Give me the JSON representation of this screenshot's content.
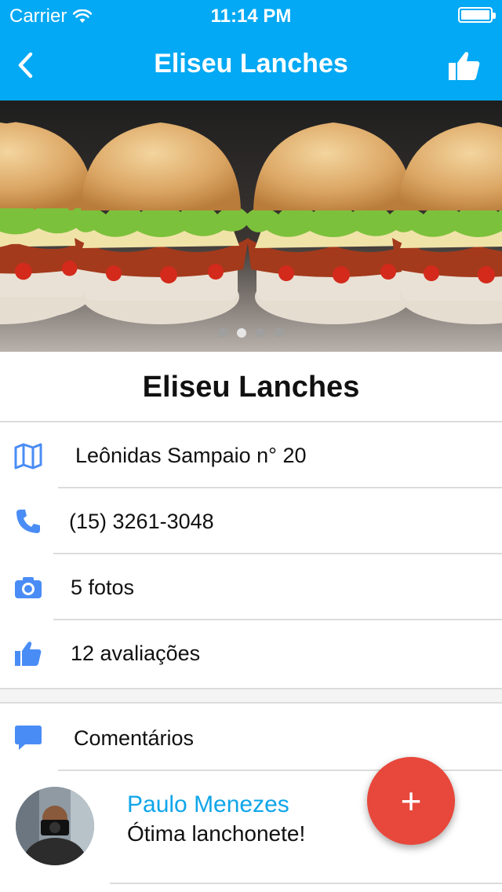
{
  "status_bar": {
    "carrier": "Carrier",
    "time": "11:14 PM"
  },
  "nav": {
    "title": "Eliseu Lanches",
    "back_icon": "chevron-left-icon",
    "like_icon": "thumbs-up-icon"
  },
  "hero": {
    "slide_count": 4,
    "active_slide": 2
  },
  "place": {
    "name": "Eliseu Lanches"
  },
  "details": {
    "address": "Leônidas Sampaio n° 20",
    "phone": "(15) 3261-3048",
    "photos": "5 fotos",
    "ratings": "12 avaliações"
  },
  "comments": {
    "header": "Comentários",
    "items": [
      {
        "author": "Paulo Menezes",
        "text": "Ótima lanchonete!"
      }
    ]
  },
  "fab": {
    "label": "+"
  },
  "colors": {
    "primary": "#03a9f4",
    "icon": "#4a8cf5",
    "fab": "#e8473b",
    "author": "#0ea5e9"
  }
}
